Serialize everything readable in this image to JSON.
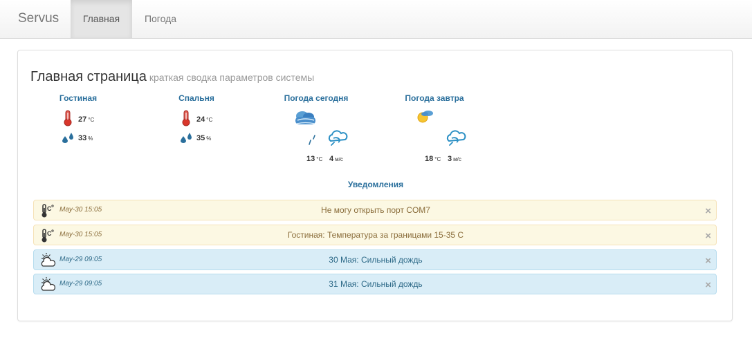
{
  "navbar": {
    "brand": "Servus",
    "items": [
      {
        "label": "Главная",
        "active": true
      },
      {
        "label": "Погода",
        "active": false
      }
    ]
  },
  "header": {
    "title": "Главная страница",
    "subtitle": "краткая сводка параметров системы"
  },
  "rooms": [
    {
      "name": "Гостиная",
      "temperature": "27",
      "temperature_unit": "°C",
      "humidity": "33",
      "humidity_unit": "%"
    },
    {
      "name": "Спальня",
      "temperature": "24",
      "temperature_unit": "°C",
      "humidity": "35",
      "humidity_unit": "%"
    }
  ],
  "weather": [
    {
      "name": "Погода сегодня",
      "temperature": "13",
      "temperature_unit": "°C",
      "wind": "4",
      "wind_unit": "м/с",
      "icon": "cloudy-rain-icon"
    },
    {
      "name": "Погода завтра",
      "temperature": "18",
      "temperature_unit": "°C",
      "wind": "3",
      "wind_unit": "м/с",
      "icon": "sun-cloud-icon"
    }
  ],
  "notifications": {
    "title": "Уведомления",
    "items": [
      {
        "time": "May-30 15:05",
        "text": "Не могу открыть порт COM7",
        "type": "warning",
        "icon": "thermometer-celsius-icon"
      },
      {
        "time": "May-30 15:05",
        "text": "Гостиная: Температура за границами 15-35 C",
        "type": "warning",
        "icon": "thermometer-celsius-icon"
      },
      {
        "time": "May-29 09:05",
        "text": "30 Мая: Сильный дождь",
        "type": "info",
        "icon": "cloud-sun-icon"
      },
      {
        "time": "May-29 09:05",
        "text": "31 Мая: Сильный дождь",
        "type": "info",
        "icon": "cloud-sun-icon"
      }
    ],
    "close_symbol": "×"
  },
  "colors": {
    "accent": "#2a6f9c",
    "warning_bg": "#fcf8e3",
    "info_bg": "#d9edf7",
    "thermometer": "#c9302c",
    "drop": "#2a6f9c"
  }
}
